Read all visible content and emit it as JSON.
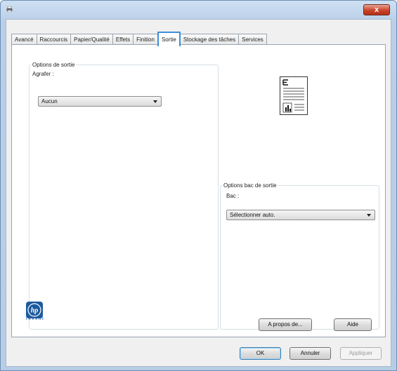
{
  "window": {
    "close_glyph": "x"
  },
  "tabs": [
    {
      "label": "Avancé"
    },
    {
      "label": "Raccourcis"
    },
    {
      "label": "Papier/Qualité"
    },
    {
      "label": "Effets"
    },
    {
      "label": "Finition"
    },
    {
      "label": "Sortie",
      "active": true
    },
    {
      "label": "Stockage des tâches"
    },
    {
      "label": "Services"
    }
  ],
  "output_options": {
    "legend": "Options de sortie",
    "staple_label": "Agrafer :",
    "staple_value": "Aucun"
  },
  "tray_options": {
    "legend": "Options bac de sortie",
    "tray_label": "Bac :",
    "tray_value": "Sélectionner auto."
  },
  "logo": {
    "text": "hp",
    "tagline": "invent"
  },
  "buttons": {
    "about": "A propos de...",
    "help": "Aide",
    "ok": "OK",
    "cancel": "Annuler",
    "apply": "Appliquer"
  },
  "colors": {
    "accent": "#3c8fd9",
    "close": "#c9452b",
    "hp_blue": "#1d5a9e"
  },
  "icons": [
    "printer-icon",
    "close-icon",
    "page-preview-icon",
    "hp-logo-icon",
    "dropdown-arrow-icon"
  ]
}
